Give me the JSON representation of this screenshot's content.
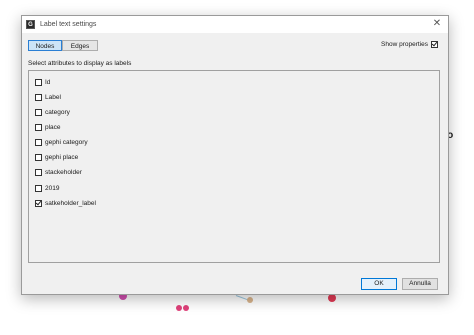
{
  "background": {
    "partial_text": "no"
  },
  "dialog": {
    "title": "Label text settings",
    "app_icon_text": "G",
    "close_glyph": "✕",
    "tabs": [
      {
        "label": "Nodes",
        "active": true
      },
      {
        "label": "Edges",
        "active": false
      }
    ],
    "show_properties": {
      "label": "Show properties",
      "checked": true
    },
    "section_label": "Select attributes to display as labels",
    "attributes": [
      {
        "label": "Id",
        "checked": false
      },
      {
        "label": "Label",
        "checked": false
      },
      {
        "label": "category",
        "checked": false
      },
      {
        "label": "place",
        "checked": false
      },
      {
        "label": "gephi category",
        "checked": false
      },
      {
        "label": "gephi place",
        "checked": false
      },
      {
        "label": "stackeholder",
        "checked": false
      },
      {
        "label": "2019",
        "checked": false
      },
      {
        "label": "satkeholder_label",
        "checked": true
      }
    ],
    "buttons": {
      "ok": "OK",
      "cancel": "Annulla"
    }
  },
  "colors": {
    "accent": "#0078d7",
    "tab_active_bg": "#cce4f7",
    "dialog_bg": "#f0f0f0"
  }
}
